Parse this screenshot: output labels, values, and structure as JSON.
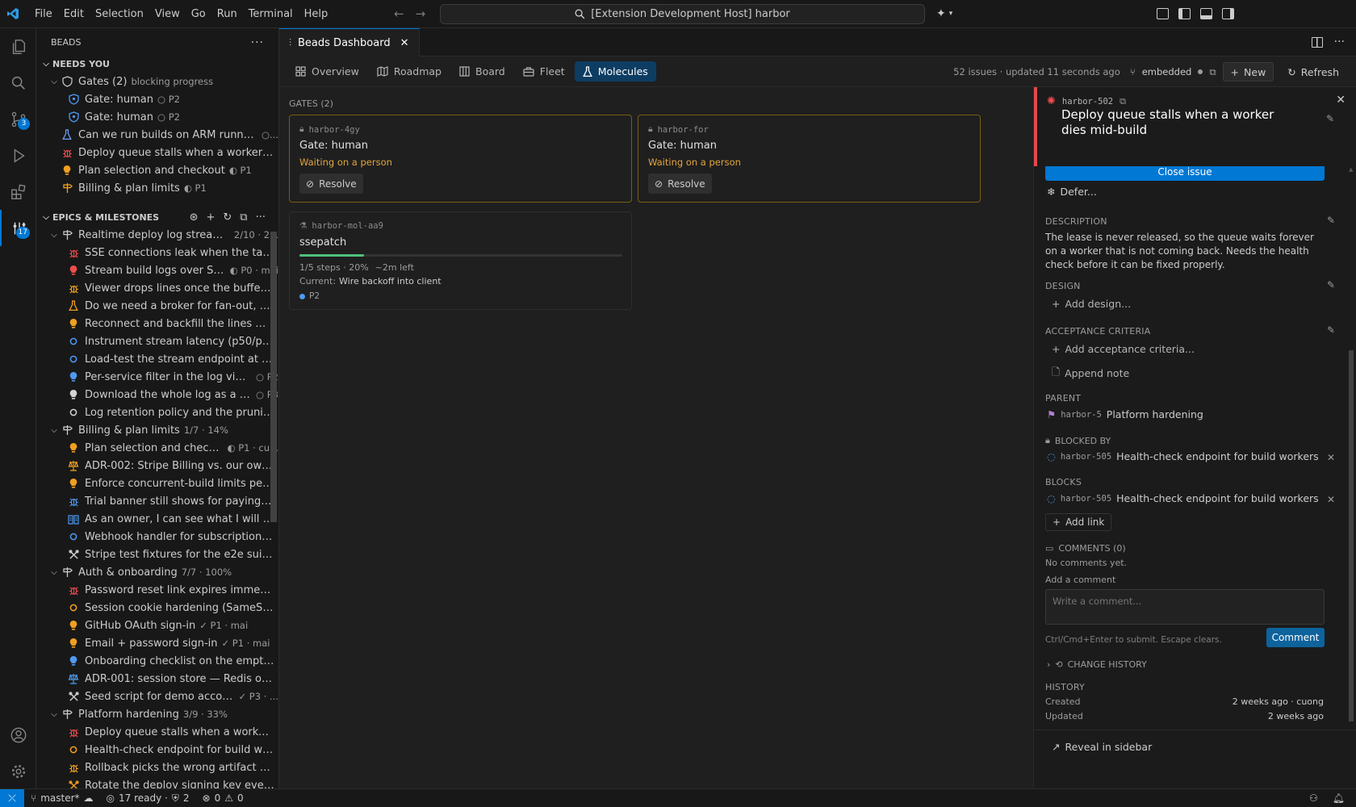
{
  "menu": [
    "File",
    "Edit",
    "Selection",
    "View",
    "Go",
    "Run",
    "Terminal",
    "Help"
  ],
  "search": {
    "text": "[Extension Development Host] harbor"
  },
  "activity": {
    "scm_badge": "3",
    "beads_badge": "17"
  },
  "sidebar": {
    "title": "BEADS",
    "needs_you": {
      "label": "NEEDS YOU",
      "gates": {
        "label": "Gates (2)",
        "meta": "blocking progress"
      },
      "gate_items": [
        {
          "label": "Gate: human",
          "meta": "○ P2"
        },
        {
          "label": "Gate: human",
          "meta": "○ P2"
        }
      ],
      "items": [
        {
          "label": "Can we run builds on ARM runners?",
          "meta": "○...",
          "icon": "flask",
          "color": "#6a9ef5"
        },
        {
          "label": "Deploy queue stalls when a worker die...",
          "meta": "",
          "icon": "bug",
          "color": "#f14c4c"
        },
        {
          "label": "Plan selection and checkout",
          "meta": "◐ P1",
          "icon": "bulb",
          "color": "#f0a020"
        },
        {
          "label": "Billing & plan limits",
          "meta": "◐ P1",
          "icon": "milestone",
          "color": "#f0a020"
        }
      ]
    },
    "epics": {
      "label": "EPICS & MILESTONES",
      "groups": [
        {
          "label": "Realtime deploy log streaming",
          "meta": "2/10 · 2...",
          "items": [
            {
              "label": "SSE connections leak when the tab cl...",
              "meta": "",
              "icon": "bug",
              "color": "#f14c4c"
            },
            {
              "label": "Stream build logs over SSE",
              "meta": "◐ P0 · mai",
              "icon": "bulb",
              "color": "#f14c4c"
            },
            {
              "label": "Viewer drops lines once the buffer pa...",
              "meta": "",
              "icon": "bug",
              "color": "#f0a020"
            },
            {
              "label": "Do we need a broker for fan-out, or i...",
              "meta": "",
              "icon": "flask",
              "color": "#f0a020"
            },
            {
              "label": "Reconnect and backfill the lines miss...",
              "meta": "",
              "icon": "bulb",
              "color": "#f0a020"
            },
            {
              "label": "Instrument stream latency (p50/p95) ...",
              "meta": "",
              "icon": "dot",
              "color": "#4e9af1"
            },
            {
              "label": "Load-test the stream endpoint at 500...",
              "meta": "",
              "icon": "dot",
              "color": "#4e9af1"
            },
            {
              "label": "Per-service filter in the log viewer",
              "meta": "○ P2",
              "icon": "bulb",
              "color": "#4e9af1"
            },
            {
              "label": "Download the whole log as a file",
              "meta": "○ P3",
              "icon": "bulb",
              "color": "#d4d4d4"
            },
            {
              "label": "Log retention policy and the pruning ...",
              "meta": "",
              "icon": "dot",
              "color": "#d4d4d4"
            }
          ]
        },
        {
          "label": "Billing & plan limits",
          "meta": "1/7 · 14%",
          "items": [
            {
              "label": "Plan selection and checkout",
              "meta": "◐ P1 · cu...",
              "icon": "bulb",
              "color": "#f0a020"
            },
            {
              "label": "ADR-002: Stripe Billing vs. our own m...",
              "meta": "",
              "icon": "scale",
              "color": "#f0a020"
            },
            {
              "label": "Enforce concurrent-build limits per pl...",
              "meta": "",
              "icon": "bulb",
              "color": "#f0a020"
            },
            {
              "label": "Trial banner still shows for paying cus...",
              "meta": "",
              "icon": "bug",
              "color": "#4e9af1"
            },
            {
              "label": "As an owner, I can see what I will be ...",
              "meta": "",
              "icon": "book",
              "color": "#4e9af1"
            },
            {
              "label": "Webhook handler for subscription lif...",
              "meta": "",
              "icon": "dot",
              "color": "#4e9af1"
            },
            {
              "label": "Stripe test fixtures for the e2e suite...",
              "meta": "",
              "icon": "tools",
              "color": "#d4d4d4"
            }
          ]
        },
        {
          "label": "Auth & onboarding",
          "meta": "7/7 · 100%",
          "items": [
            {
              "label": "Password reset link expires immediat...",
              "meta": "",
              "icon": "bug",
              "color": "#f14c4c"
            },
            {
              "label": "Session cookie hardening (SameSite, ...",
              "meta": "",
              "icon": "dot",
              "color": "#f0a020"
            },
            {
              "label": "GitHub OAuth sign-in",
              "meta": "✓ P1 · mai",
              "icon": "bulb",
              "color": "#f0a020"
            },
            {
              "label": "Email + password sign-in",
              "meta": "✓ P1 · mai",
              "icon": "bulb",
              "color": "#f0a020"
            },
            {
              "label": "Onboarding checklist on the empty d...",
              "meta": "",
              "icon": "bulb",
              "color": "#4e9af1"
            },
            {
              "label": "ADR-001: session store — Redis over...",
              "meta": "",
              "icon": "scale",
              "color": "#4e9af1"
            },
            {
              "label": "Seed script for demo accounts",
              "meta": "✓ P3 · ...",
              "icon": "tools",
              "color": "#d4d4d4"
            }
          ]
        },
        {
          "label": "Platform hardening",
          "meta": "3/9 · 33%",
          "items": [
            {
              "label": "Deploy queue stalls when a worker di...",
              "meta": "",
              "icon": "bug",
              "color": "#f14c4c"
            },
            {
              "label": "Health-check endpoint for build wor...",
              "meta": "",
              "icon": "dot",
              "color": "#f0a020"
            },
            {
              "label": "Rollback picks the wrong artifact whe...",
              "meta": "",
              "icon": "bug",
              "color": "#f0a020"
            },
            {
              "label": "Rotate the deploy signing key every ...",
              "meta": "",
              "icon": "tools",
              "color": "#f0a020"
            }
          ]
        }
      ]
    }
  },
  "tab": {
    "label": "Beads Dashboard"
  },
  "nav": {
    "items": [
      {
        "label": "Overview",
        "icon": "grid"
      },
      {
        "label": "Roadmap",
        "icon": "map"
      },
      {
        "label": "Board",
        "icon": "board"
      },
      {
        "label": "Fleet",
        "icon": "fleet"
      },
      {
        "label": "Molecules",
        "icon": "flask"
      }
    ],
    "active": "Molecules",
    "summary": "52 issues · updated 11 seconds ago",
    "mode": "embedded",
    "new_label": "New",
    "refresh_label": "Refresh"
  },
  "gates_panel": {
    "label": "GATES (2)",
    "gates": [
      {
        "id": "harbor-4gy",
        "title": "Gate: human",
        "status": "Waiting on a person",
        "action": "Resolve"
      },
      {
        "id": "harbor-for",
        "title": "Gate: human",
        "status": "Waiting on a person",
        "action": "Resolve"
      }
    ],
    "molecule": {
      "id": "harbor-mol-aa9",
      "title": "ssepatch",
      "progress": 0.2,
      "steps": "1/5 steps · 20%",
      "eta": "~2m left",
      "current_label": "Current:",
      "current": "Wire backoff into client",
      "priority": "P2"
    }
  },
  "detail": {
    "id": "harbor-502",
    "title": "Deploy queue stalls when a worker dies mid-build",
    "close_label": "Close issue",
    "defer_label": "Defer...",
    "description_label": "DESCRIPTION",
    "description": "The lease is never released, so the queue waits forever on a worker that is not coming back. Needs the health check before it can be fixed properly.",
    "design_label": "DESIGN",
    "design_add": "Add design...",
    "acceptance_label": "ACCEPTANCE CRITERIA",
    "acceptance_add": "Add acceptance criteria...",
    "append_note": "Append note",
    "parent_label": "PARENT",
    "parent": {
      "id": "harbor-5",
      "title": "Platform hardening"
    },
    "blocked_by_label": "BLOCKED BY",
    "blocked_by": {
      "id": "harbor-505",
      "title": "Health-check endpoint for build workers"
    },
    "blocks_label": "BLOCKS",
    "blocks": {
      "id": "harbor-505",
      "title": "Health-check endpoint for build workers"
    },
    "add_link": "Add link",
    "comments_label": "COMMENTS (0)",
    "no_comments": "No comments yet.",
    "add_comment": "Add a comment",
    "comment_placeholder": "Write a comment...",
    "comment_hint": "Ctrl/Cmd+Enter to submit. Escape clears.",
    "comment_button": "Comment",
    "change_history": "CHANGE HISTORY",
    "history_label": "HISTORY",
    "created_label": "Created",
    "created_value": "2 weeks ago · cuong",
    "updated_label": "Updated",
    "updated_value": "2 weeks ago",
    "reveal": "Reveal in sidebar"
  },
  "status": {
    "branch": "master*",
    "ready": "17 ready · ",
    "gates": "2",
    "errors": "0",
    "warnings": "0"
  }
}
